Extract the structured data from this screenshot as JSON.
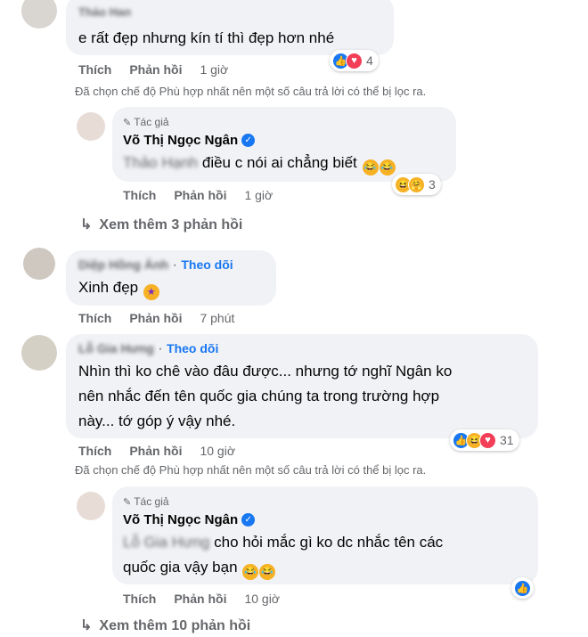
{
  "comments": [
    {
      "author_name": "Thảo Han",
      "text": "e rất đẹp nhưng kín tí thì đẹp hơn nhé",
      "actions": {
        "like": "Thích",
        "reply": "Phản hồi",
        "time": "1 giờ"
      },
      "reaction_count": "4",
      "filter_note": "Đã chọn chế độ Phù hợp nhất nên một số câu trả lời có thể bị lọc ra.",
      "reply": {
        "author_tag": "Tác giả",
        "author_name": "Võ Thị Ngọc Ngân",
        "text_blurred": "Thảo Hạnh",
        "text": "điều c nói ai chẳng biết",
        "actions": {
          "like": "Thích",
          "reply": "Phản hồi",
          "time": "1 giờ"
        },
        "reaction_count": "3"
      },
      "more_replies": "Xem thêm 3 phản hồi"
    },
    {
      "author_name": "Diệp Hồng Ánh",
      "follow": "Theo dõi",
      "text": "Xinh đẹp",
      "actions": {
        "like": "Thích",
        "reply": "Phản hồi",
        "time": "7 phút"
      }
    },
    {
      "author_name": "Lỗ Gia Hưng",
      "follow": "Theo dõi",
      "text_lines": [
        "Nhìn thì ko chê vào đâu được... nhưng tớ nghĩ Ngân ko",
        "nên nhắc đến tên quốc gia chúng ta trong trường hợp",
        "này... tớ góp ý vậy nhé."
      ],
      "actions": {
        "like": "Thích",
        "reply": "Phản hồi",
        "time": "10 giờ"
      },
      "reaction_count": "31",
      "filter_note": "Đã chọn chế độ Phù hợp nhất nên một số câu trả lời có thể bị lọc ra.",
      "reply": {
        "author_tag": "Tác giả",
        "author_name": "Võ Thị Ngọc Ngân",
        "text_blurred": "Lỗ Gia Hưng",
        "text_line1": "cho hỏi mắc gì ko dc nhắc tên các",
        "text_line2": "quốc gia vậy bạn",
        "actions": {
          "like": "Thích",
          "reply": "Phản hồi",
          "time": "10 giờ"
        }
      },
      "more_replies": "Xem thêm 10 phản hồi"
    }
  ]
}
